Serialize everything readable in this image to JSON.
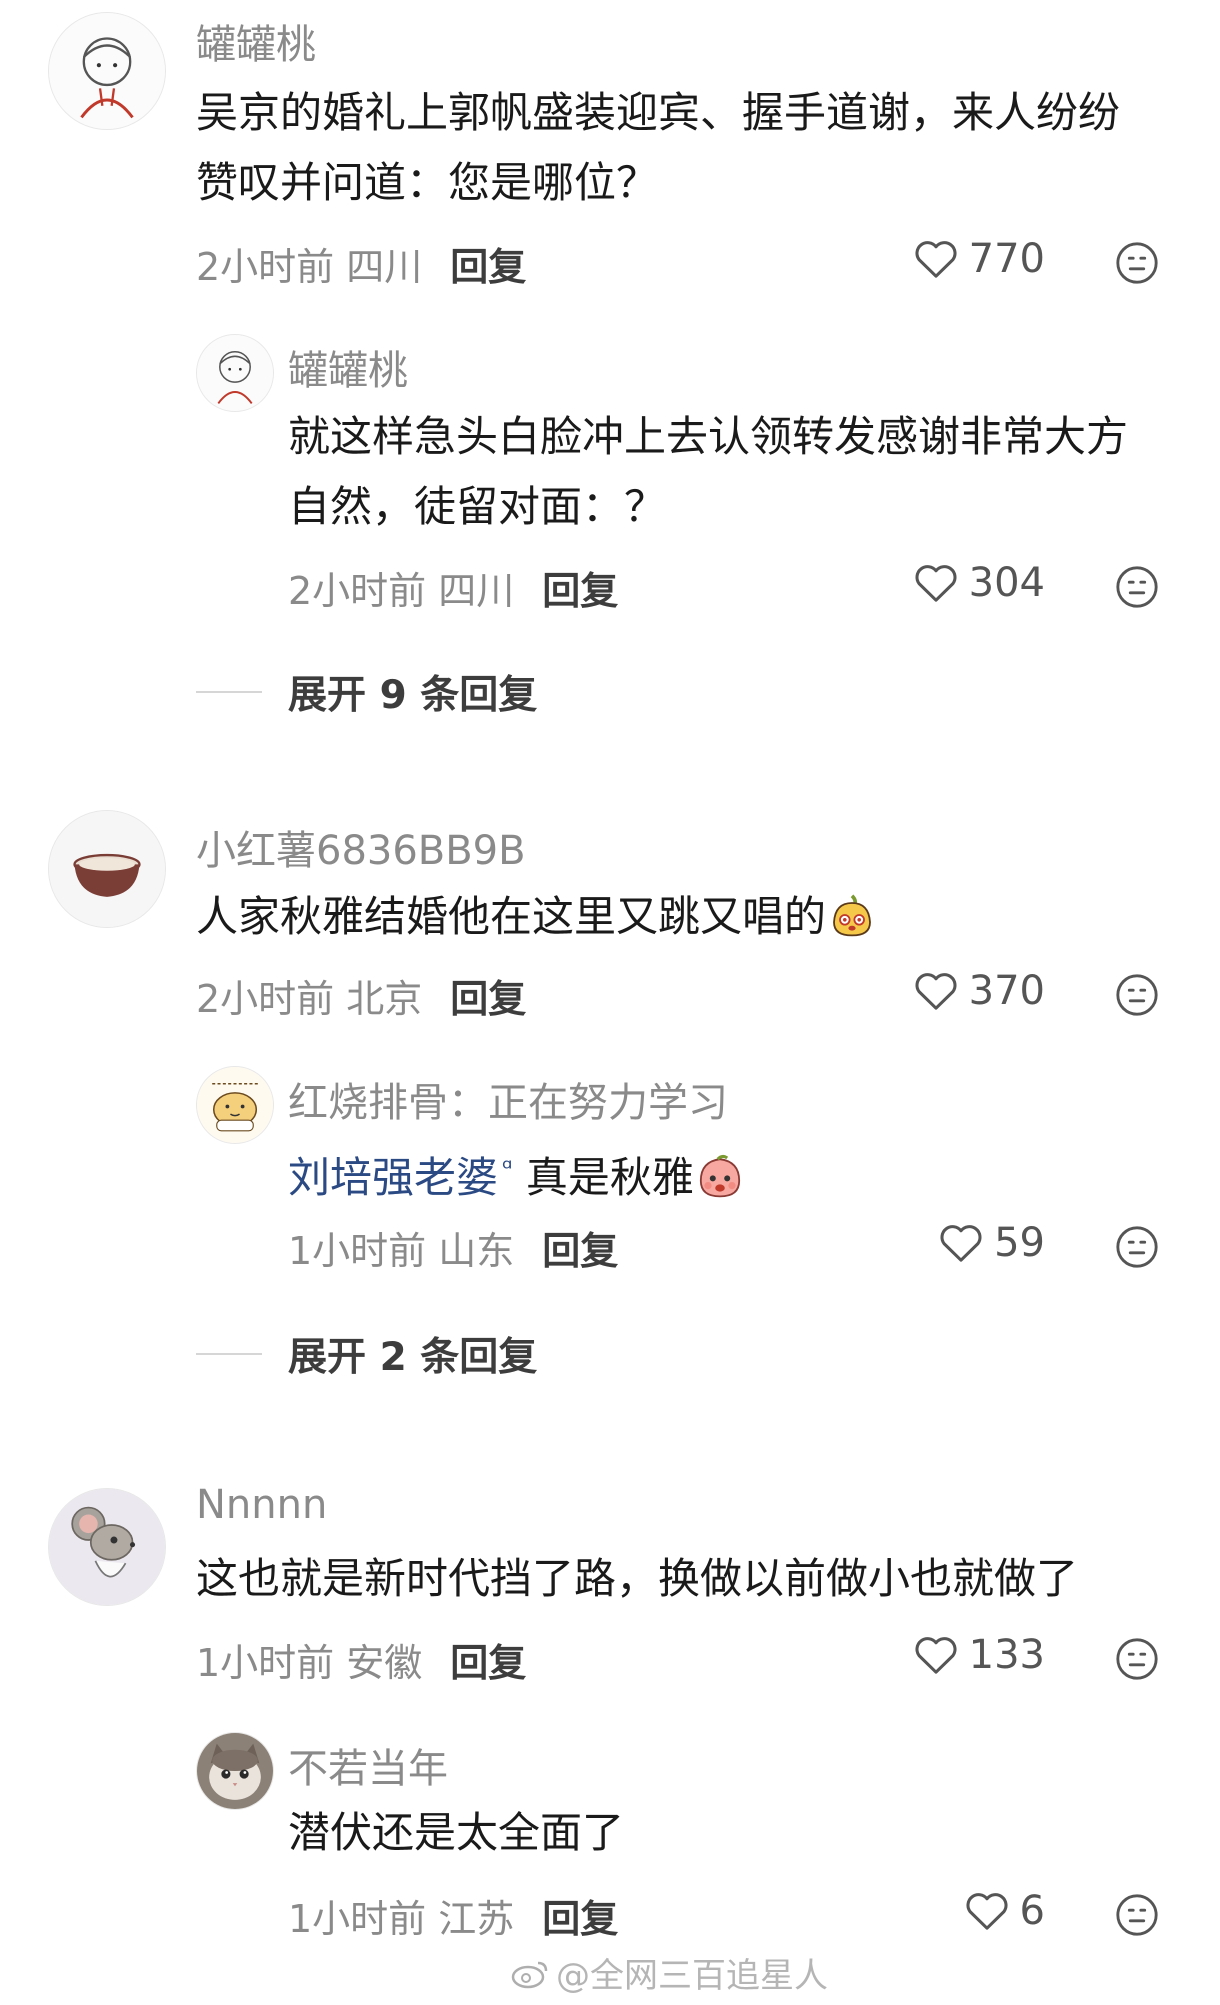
{
  "comments": [
    {
      "user": "罐罐桃",
      "text": "吴京的婚礼上郭帆盛装迎宾、握手道谢，来人纷纷赞叹并问道：您是哪位？",
      "time": "2小时前",
      "location": "四川",
      "reply_label": "回复",
      "likes": "770",
      "replies": [
        {
          "user": "罐罐桃",
          "text": "就这样急头白脸冲上去认领转发感谢非常大方自然，徒留对面：？",
          "time": "2小时前",
          "location": "四川",
          "reply_label": "回复",
          "likes": "304"
        }
      ],
      "expand_label": "展开 9 条回复"
    },
    {
      "user": "小红薯6836BB9B",
      "text": "人家秋雅结婚他在这里又跳又唱的",
      "time": "2小时前",
      "location": "北京",
      "reply_label": "回复",
      "likes": "370",
      "replies": [
        {
          "user": "红烧排骨：正在努力学习",
          "mention": "刘培强老婆",
          "mention_mark": "ᵅ",
          "text": "真是秋雅",
          "time": "1小时前",
          "location": "山东",
          "reply_label": "回复",
          "likes": "59"
        }
      ],
      "expand_label": "展开 2 条回复"
    },
    {
      "user": "Nnnnn",
      "text": "这也就是新时代挡了路，换做以前做小也就做了",
      "time": "1小时前",
      "location": "安徽",
      "reply_label": "回复",
      "likes": "133",
      "replies": [
        {
          "user": "不若当年",
          "text": "潜伏还是太全面了",
          "time": "1小时前",
          "location": "江苏",
          "reply_label": "回复",
          "likes": "6"
        }
      ]
    }
  ],
  "icons": {
    "like": "heart-outline-icon",
    "react": "neutral-face-icon",
    "emoji_1": "yellow-character-emoji",
    "emoji_2": "peach-character-emoji"
  },
  "watermark": "@全网三百追星人"
}
